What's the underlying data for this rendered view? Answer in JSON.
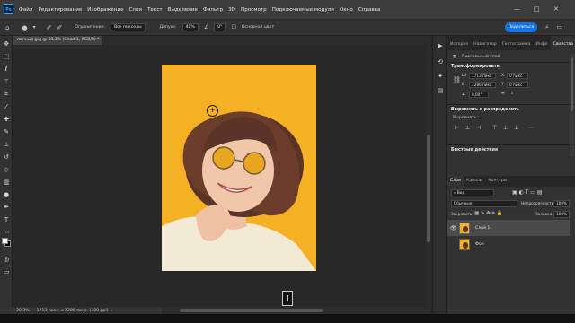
{
  "menu": {
    "logo": "Ps",
    "items": [
      "Файл",
      "Редактирование",
      "Изображение",
      "Слои",
      "Текст",
      "Выделение",
      "Фильтр",
      "3D",
      "Просмотр",
      "Подключаемые модули",
      "Окно",
      "Справка"
    ]
  },
  "window_controls": {
    "minimize": "—",
    "maximize": "□",
    "close": "✕"
  },
  "options": {
    "sample_label": "Ограничение:",
    "sample_value": "Все пикселы",
    "tolerance_label": "Допуск:",
    "tolerance_value": "40%",
    "angle_value": "0°",
    "layer_label": "Основной цвет",
    "share_label": "Поделиться"
  },
  "document": {
    "tab_title": "полный.jpg @ 30,3% (Слой 1, RGB/8) *",
    "tab_close": "×",
    "zoom": "30,3%",
    "status_info": "1713 пикс. x 2286 пикс. (300 ppi)",
    "status_arrow": "›",
    "cursor_symbol": "+",
    "bracket_key": "]"
  },
  "tools": [
    "move-icon",
    "marquee-icon",
    "lasso-icon",
    "magic-wand-icon",
    "crop-icon",
    "eyedropper-icon",
    "healing-icon",
    "brush-icon",
    "stamp-icon",
    "history-brush-icon",
    "eraser-icon",
    "gradient-icon",
    "dodge-icon",
    "pen-icon",
    "type-icon",
    "path-select-icon",
    "shape-icon",
    "hand-icon",
    "zoom-icon",
    "more-icon"
  ],
  "panel_tabs": [
    "История",
    "Навигатор",
    "Гистограмма",
    "Инфо",
    "Свойства"
  ],
  "properties": {
    "layer_type": "Пиксельный слой",
    "transform_header": "Трансформировать",
    "w_label": "Ш",
    "w_value": "1713 пикс.",
    "h_label": "В",
    "h_value": "2286 пикс.",
    "x_label": "X",
    "x_value": "0 пикс.",
    "y_label": "Y",
    "y_value": "0 пикс.",
    "angle_value": "0,00°",
    "align_header": "Выровнять и распределить",
    "align_label": "Выровнять:",
    "quick_header": "Быстрые действия"
  },
  "layers_tabs": [
    "Слои",
    "Каналы",
    "Контуры"
  ],
  "layers": {
    "filter_value": "Вид",
    "blend_mode": "Обычные",
    "opacity_label": "Непрозрачность:",
    "opacity_value": "100%",
    "lock_label": "Закрепить:",
    "fill_label": "Заливка:",
    "fill_value": "100%",
    "items": [
      {
        "name": "Слой 1",
        "visible": true,
        "selected": true
      },
      {
        "name": "Фон",
        "visible": false,
        "selected": false
      }
    ]
  },
  "colors": {
    "accent": "#1473e6",
    "canvas_bg": "#f6b024",
    "panel_bg": "#323232",
    "hair": "#5a3426",
    "skin": "#f1c7ac",
    "shirt": "#f3ead6"
  }
}
